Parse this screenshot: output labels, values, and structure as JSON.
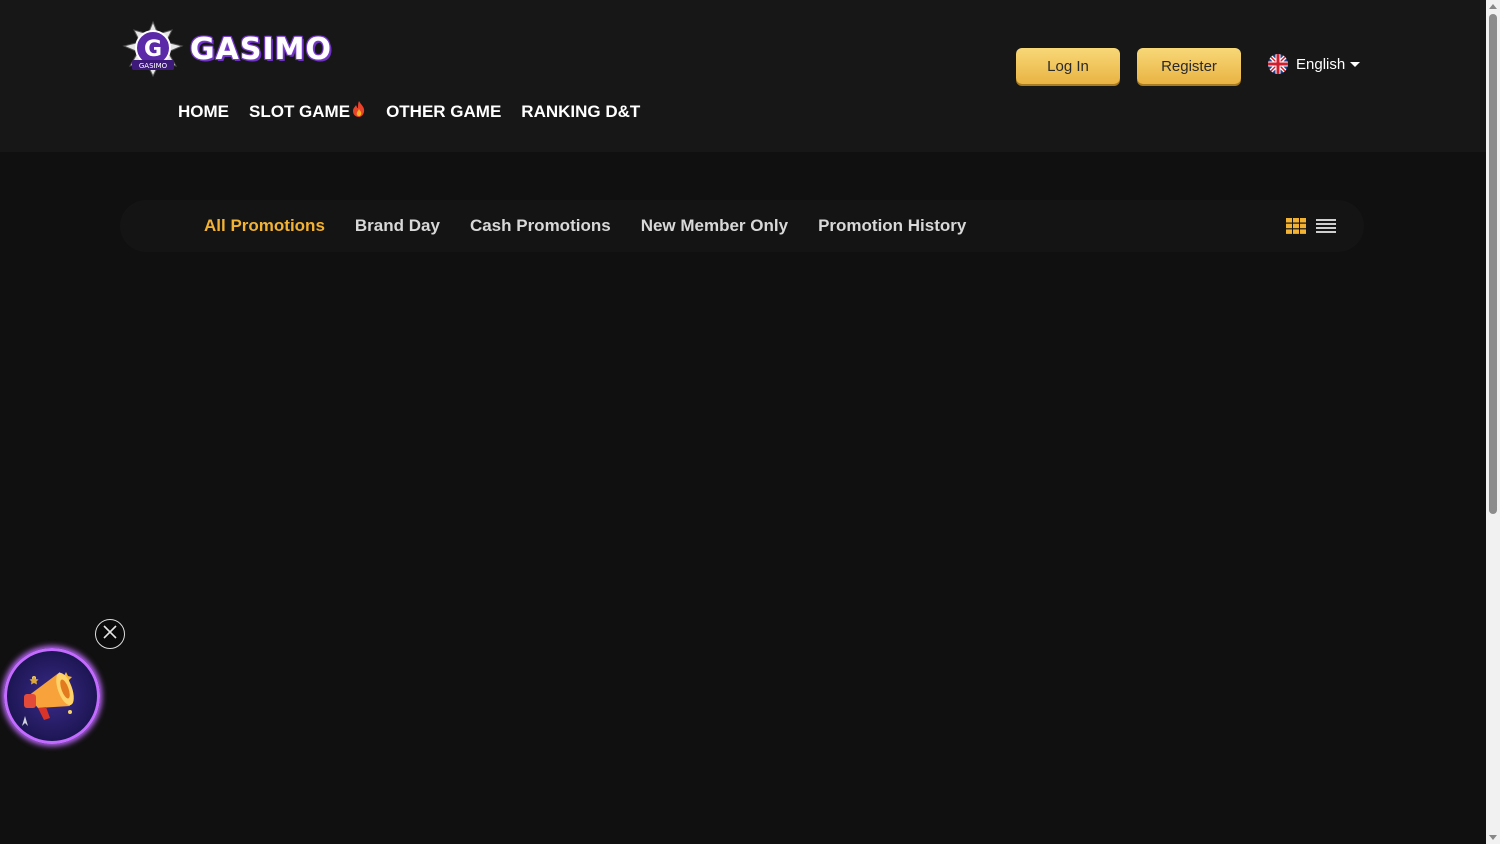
{
  "header": {
    "brand": "GASIMO",
    "badge_text": "GASIMO",
    "nav": [
      {
        "label": "HOME"
      },
      {
        "label": "SLOT GAME"
      },
      {
        "label": "OTHER GAME"
      },
      {
        "label": "RANKING D&T"
      }
    ],
    "login_label": "Log In",
    "register_label": "Register",
    "language": "English"
  },
  "promotions": {
    "tabs": [
      {
        "label": "All Promotions",
        "active": true
      },
      {
        "label": "Brand Day",
        "active": false
      },
      {
        "label": "Cash Promotions",
        "active": false
      },
      {
        "label": "New Member Only",
        "active": false
      },
      {
        "label": "Promotion History",
        "active": false
      }
    ]
  },
  "colors": {
    "accent": "#f2b233",
    "button_gold": "#f0c55a",
    "background": "#101010",
    "header_bg": "#171717"
  },
  "icons": {
    "hot": "fire-icon",
    "flag": "uk-flag-icon",
    "grid_view": "grid-view-icon",
    "list_view": "list-view-icon",
    "close": "close-icon",
    "megaphone": "megaphone-icon"
  }
}
